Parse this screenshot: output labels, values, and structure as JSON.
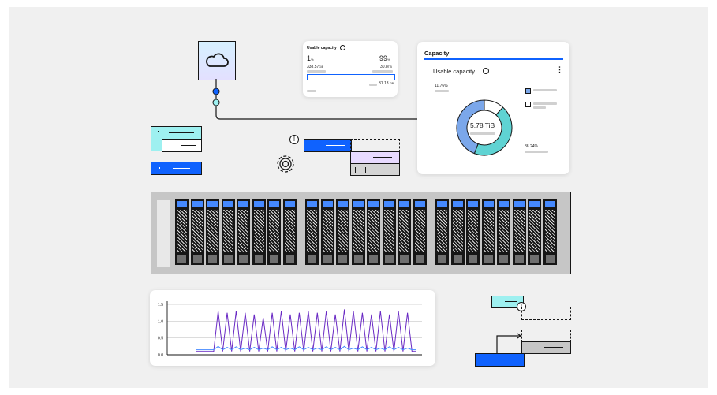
{
  "small_card": {
    "title": "Usable capacity",
    "left_value": "1",
    "left_unit": "%",
    "right_value": "99",
    "right_unit": "%",
    "left_sub_value": "338.57",
    "left_sub_unit": "GiB",
    "right_sub_value": "30.8",
    "right_sub_unit": "TiB",
    "total_value": "31.13",
    "total_unit": "TiB",
    "used_fraction": 0.01
  },
  "capacity_panel": {
    "header": "Capacity",
    "subtitle": "Usable capacity",
    "center_label": "5.78 TiB",
    "label_top_left": "11.76%",
    "label_bottom_right": "88.24%",
    "segments": [
      {
        "value": 11.76,
        "color": "#ffffff"
      },
      {
        "value": 44.12,
        "color": "#5fd3d3"
      },
      {
        "value": 44.12,
        "color": "#7ba7ea"
      }
    ]
  },
  "colors": {
    "blue": "#0f62fe",
    "teal": "#9ef0f0",
    "lavender": "#e8daff",
    "gray_box": "#c6c6c6",
    "purple_line": "#6929c4",
    "blue_line": "#4589ff"
  },
  "chart_data": {
    "type": "line",
    "yticks": [
      "1.5",
      "1.0",
      "0.5",
      "0.0"
    ],
    "ylim": [
      0,
      1.5
    ],
    "series": [
      {
        "values": [
          0.1,
          0.1,
          0.1,
          0.1,
          0.1,
          1.3,
          0.1,
          1.25,
          0.1,
          1.3,
          0.1,
          1.25,
          0.1,
          1.2,
          0.1,
          1.1,
          0.1,
          1.25,
          0.1,
          1.3,
          0.1,
          1.2,
          0.1,
          1.25,
          0.1,
          1.3,
          0.1,
          1.25,
          0.1,
          1.3,
          0.1,
          1.2,
          0.1,
          1.35,
          0.1,
          1.3,
          0.1,
          1.25,
          0.1,
          1.2,
          0.1,
          1.3,
          0.1,
          1.2,
          0.1,
          1.3,
          0.1,
          1.25,
          0.1,
          0.1
        ]
      },
      {
        "values": [
          0.15,
          0.15,
          0.15,
          0.15,
          0.15,
          0.25,
          0.15,
          0.22,
          0.15,
          0.24,
          0.15,
          0.2,
          0.15,
          0.22,
          0.15,
          0.2,
          0.15,
          0.24,
          0.15,
          0.22,
          0.15,
          0.2,
          0.15,
          0.24,
          0.15,
          0.22,
          0.15,
          0.2,
          0.15,
          0.24,
          0.15,
          0.22,
          0.15,
          0.25,
          0.15,
          0.2,
          0.15,
          0.24,
          0.15,
          0.22,
          0.15,
          0.2,
          0.15,
          0.24,
          0.15,
          0.22,
          0.15,
          0.2,
          0.15,
          0.15
        ]
      }
    ]
  }
}
